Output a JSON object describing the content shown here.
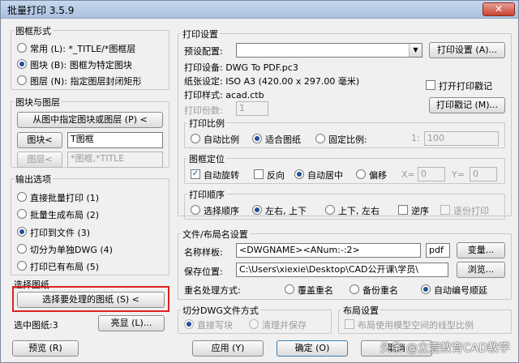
{
  "window": {
    "title": "批量打印 3.5.9",
    "close": "✕"
  },
  "shape": {
    "title": "图框形式",
    "normal": "常用 (L): *_TITLE/*图框层",
    "block": "图块 (B): 图框为特定图块",
    "layer": "图层 (N): 指定图层封闭矩形"
  },
  "blocklayer": {
    "title": "图块与图层",
    "pick_btn": "从图中指定图块或图层 (P) <",
    "block_btn": "图块<",
    "block_val": "T图框",
    "layer_btn": "图层<",
    "layer_val": "*图框,*TITLE"
  },
  "output": {
    "title": "输出选项",
    "o1": "直接批量打印 (1)",
    "o2": "批量生成布局 (2)",
    "o3": "打印到文件 (3)",
    "o4": "切分为单独DWG (4)",
    "o5": "打印已有布局 (5)"
  },
  "select": {
    "title": "选择图纸",
    "btn": "选择要处理的图纸 (S) <",
    "count_label": "选中图纸:3",
    "highlight_btn": "亮显 (L)..."
  },
  "print": {
    "title": "打印设置",
    "preset_label": "预设配置:",
    "preset_val": "",
    "setup_btn": "打印设置 (A)...",
    "device": "打印设备: DWG To PDF.pc3",
    "paper": "纸张设定: ISO A3 (420.00 x 297.00 毫米)",
    "style": "打印样式: acad.ctb",
    "stamp_chk": "打开打印戳记",
    "copies_label": "打印份数:",
    "copies_val": "1",
    "stamp_btn": "打印戳记 (M)..."
  },
  "scale": {
    "title": "打印比例",
    "auto": "自动比例",
    "fit": "适合图纸",
    "fixed": "固定比例:",
    "one": "1:",
    "val": "100"
  },
  "position": {
    "title": "图框定位",
    "rotate": "自动旋转",
    "reverse": "反向",
    "center": "自动居中",
    "offset": "偏移",
    "x": "X=",
    "x_val": "0",
    "y": "Y=",
    "y_val": "0"
  },
  "order": {
    "title": "打印顺序",
    "o1": "选择顺序",
    "o2": "左右, 上下",
    "o3": "上下, 左右",
    "rev": "逆序",
    "page": "逐份打印"
  },
  "file": {
    "title": "文件/布局名设置",
    "name_label": "名称样板:",
    "name_val": "<DWGNAME><ANum:-:2>",
    "ext": "pdf",
    "change_btn": "变量...",
    "path_label": "保存位置:",
    "path_val": "C:\\Users\\xiexie\\Desktop\\CAD公开课\\学员\\",
    "browse_btn": "浏览...",
    "rename_label": "重名处理方式:",
    "r1": "覆盖重名",
    "r2": "备份重名",
    "r3": "自动编号顺延"
  },
  "split": {
    "title": "切分DWG文件方式",
    "o1": "直接写块",
    "o2": "清理并保存"
  },
  "layout": {
    "title": "布局设置",
    "chk": "布局使用模型空间的线型比例"
  },
  "footer": {
    "preview": "预览 (R)",
    "apply": "应用 (Y)",
    "ok": "确定 (O)",
    "cancel": "取消"
  },
  "watermark": "头条 @立壹教育CAD教学"
}
